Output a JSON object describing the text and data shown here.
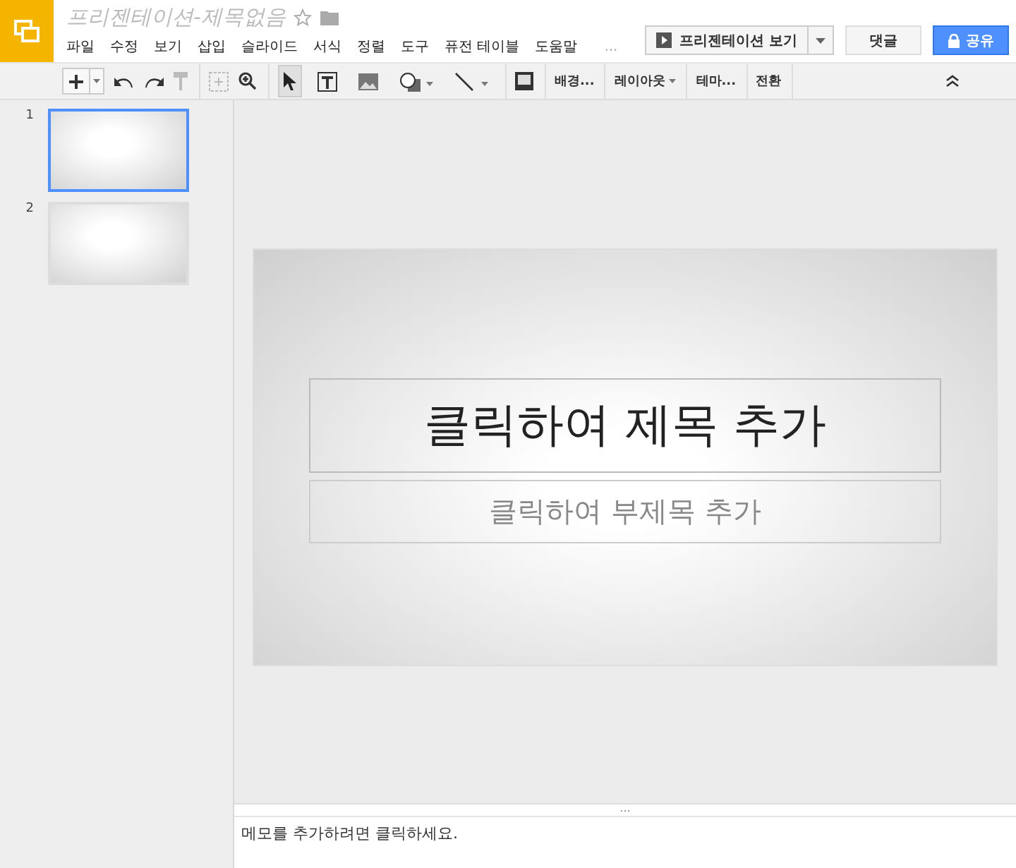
{
  "title": "프리젠테이션-제목없음",
  "menu": [
    "파일",
    "수정",
    "보기",
    "삽입",
    "슬라이드",
    "서식",
    "정렬",
    "도구",
    "퓨전 테이블",
    "도움말"
  ],
  "menu_more": "...",
  "present_button": "프리젠테이션 보기",
  "comment_button": "댓글",
  "share_button": "공유",
  "tools": [
    {
      "kind": "select",
      "selected": true
    },
    {
      "kind": "textbox",
      "selected": false
    },
    {
      "kind": "image",
      "selected": false
    },
    {
      "kind": "shape",
      "selected": false
    },
    {
      "kind": "line",
      "selected": false
    }
  ],
  "toolbar_buttons": [
    {
      "label": "배경...",
      "dropdown": false
    },
    {
      "label": "레이아웃",
      "dropdown": true
    },
    {
      "label": "테마...",
      "dropdown": false
    },
    {
      "label": "전환",
      "dropdown": false
    }
  ],
  "slides": [
    {
      "number": "1",
      "selected": true
    },
    {
      "number": "2",
      "selected": false
    }
  ],
  "slide": {
    "title_placeholder": "클릭하여 제목 추가",
    "subtitle_placeholder": "클릭하여 부제목 추가"
  },
  "notes_handle": "...",
  "notes": {
    "placeholder": "메모를 추가하려면 클릭하세요."
  }
}
